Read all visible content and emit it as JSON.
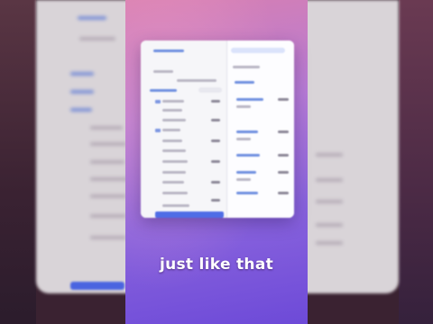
{
  "video": {
    "caption": "just like that"
  },
  "colors": {
    "accent": "#4f6de6",
    "strip_top": "#d77fb1",
    "strip_bottom": "#6d4ad8"
  }
}
